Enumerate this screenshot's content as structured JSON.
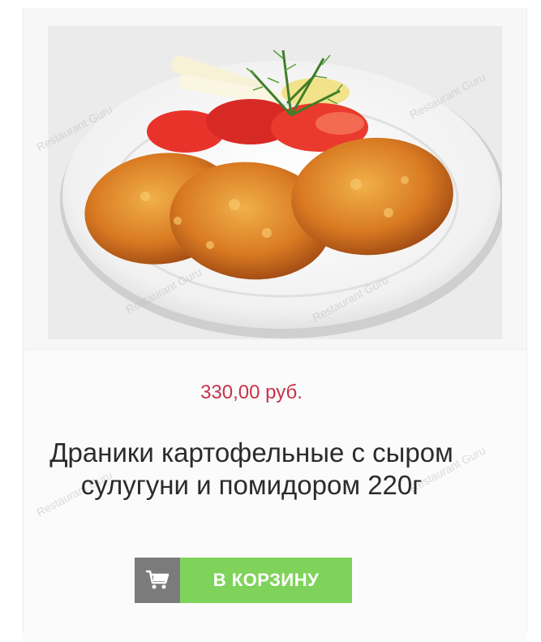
{
  "product": {
    "price": "330,00 руб.",
    "title": "Драники картофельные с сыром сулугуни и помидором 220г",
    "image_alt": "Драники картофельные"
  },
  "cart": {
    "icon": "shopping-cart-icon",
    "add_label": "В КОРЗИНУ"
  },
  "watermark": "Restaurant Guru",
  "colors": {
    "price": "#c8324a",
    "add_button": "#7fd35a",
    "cart_icon_bg": "#7b7b7b"
  }
}
